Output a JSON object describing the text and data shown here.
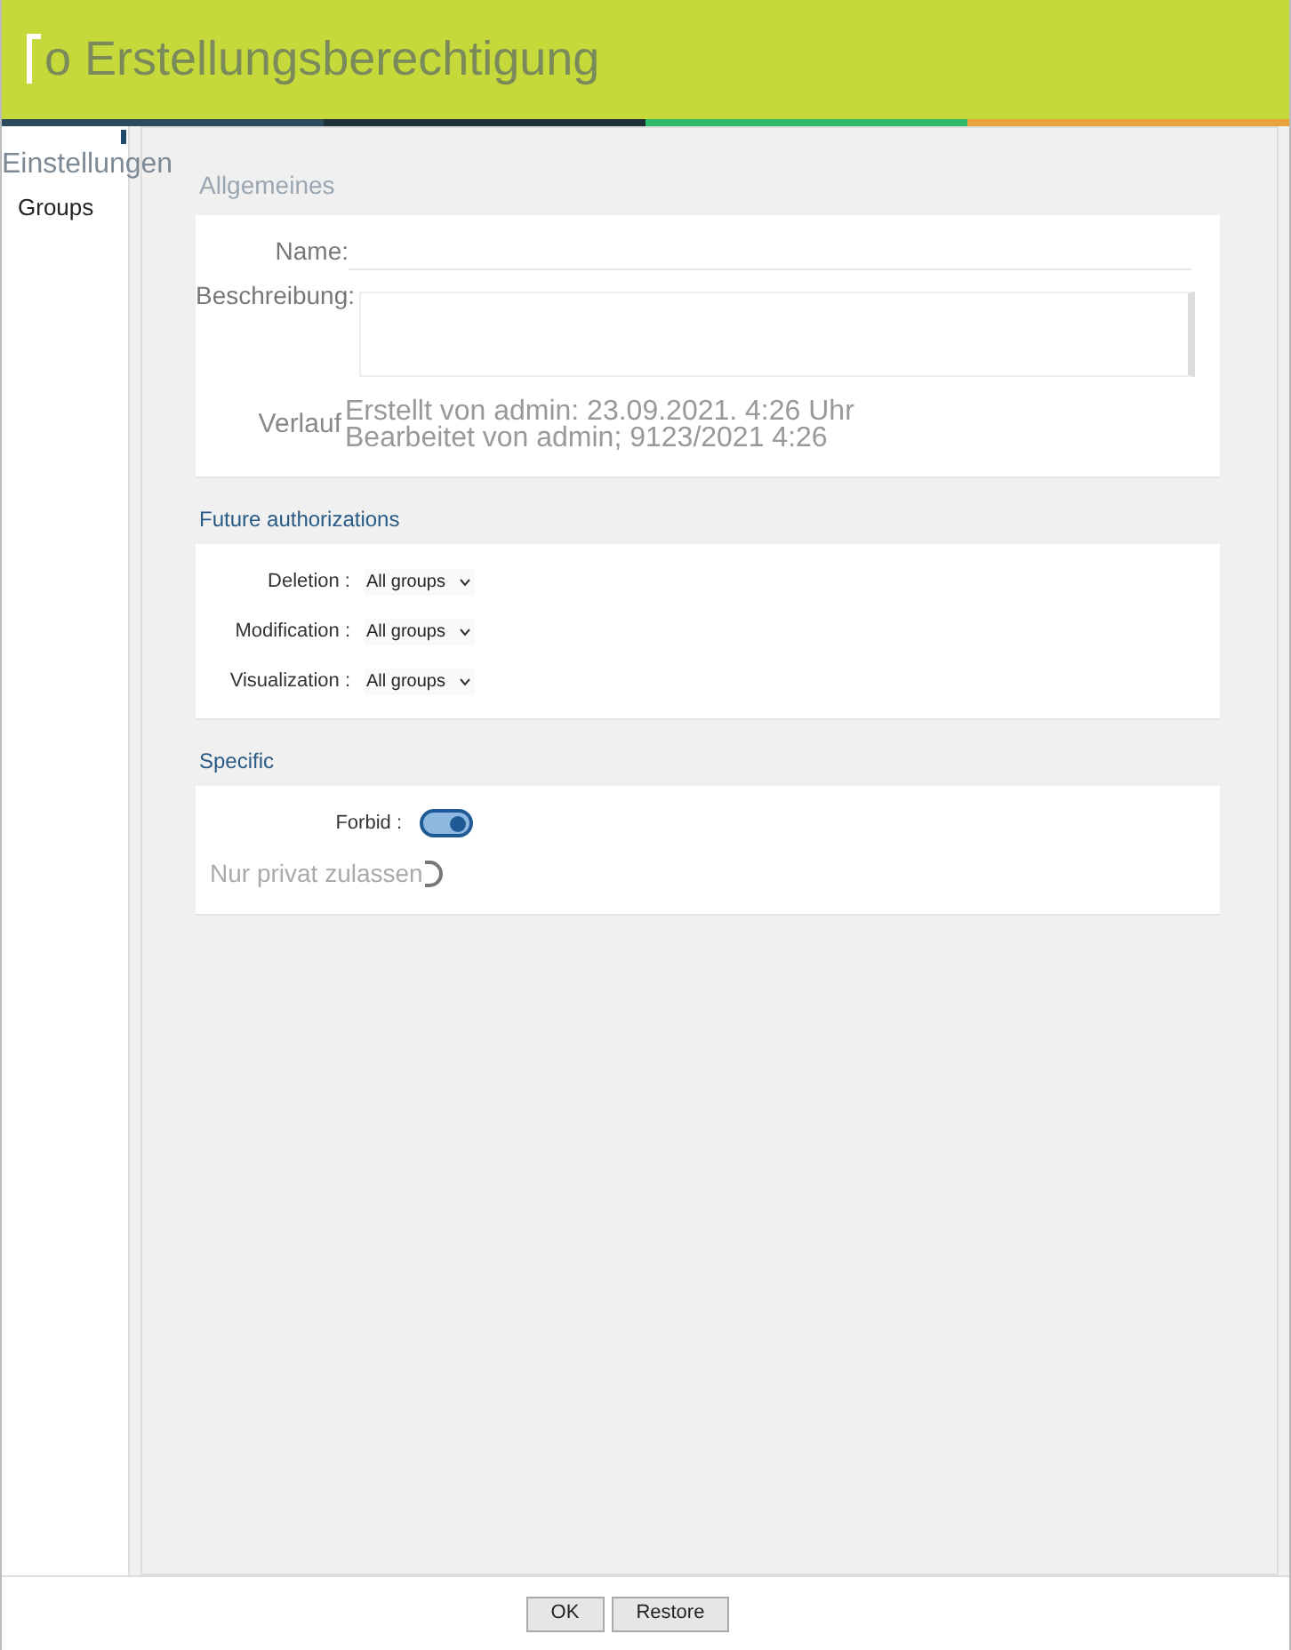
{
  "window": {
    "title": "o Erstellungsberechtigung"
  },
  "sidebar": {
    "heading": "Einstellungen",
    "items": [
      {
        "label": "Groups",
        "selected": false
      }
    ]
  },
  "general": {
    "heading": "Allgemeines",
    "name_label": "Name:",
    "description_label": "Beschreibung:",
    "history_label": "Verlauf",
    "history": [
      "Erstellt von admin: 23.09.2021. 4:26 Uhr",
      "Bearbeitet von admin; 9123/2021 4:26"
    ]
  },
  "future_authorizations": {
    "heading": "Future authorizations",
    "rows": [
      {
        "label": "Deletion :",
        "value": "All groups"
      },
      {
        "label": "Modification :",
        "value": "All groups"
      },
      {
        "label": "Visualization :",
        "value": "All groups"
      }
    ]
  },
  "specific": {
    "heading": "Specific",
    "toggles": [
      {
        "label": "Forbid :",
        "on": true,
        "kind": "switch"
      },
      {
        "label": "Nur privat zulassen",
        "on": false,
        "kind": "loading"
      }
    ]
  },
  "buttons": [
    "OK",
    "Restore"
  ]
}
